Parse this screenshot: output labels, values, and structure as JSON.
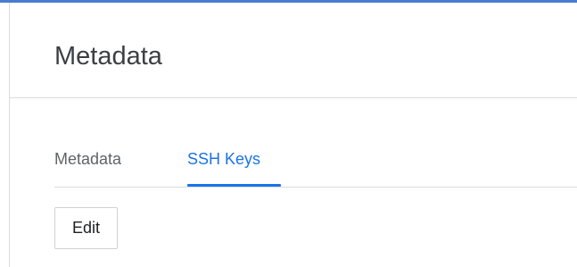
{
  "page": {
    "title": "Metadata"
  },
  "tabs": [
    {
      "label": "Metadata",
      "active": false
    },
    {
      "label": "SSH Keys",
      "active": true
    }
  ],
  "actions": {
    "edit_label": "Edit"
  },
  "colors": {
    "accent": "#1a73e8",
    "top_bar": "#4a7bd0",
    "divider": "#dadce0",
    "title_text": "#3c4043",
    "inactive_tab_text": "#5f6368"
  }
}
